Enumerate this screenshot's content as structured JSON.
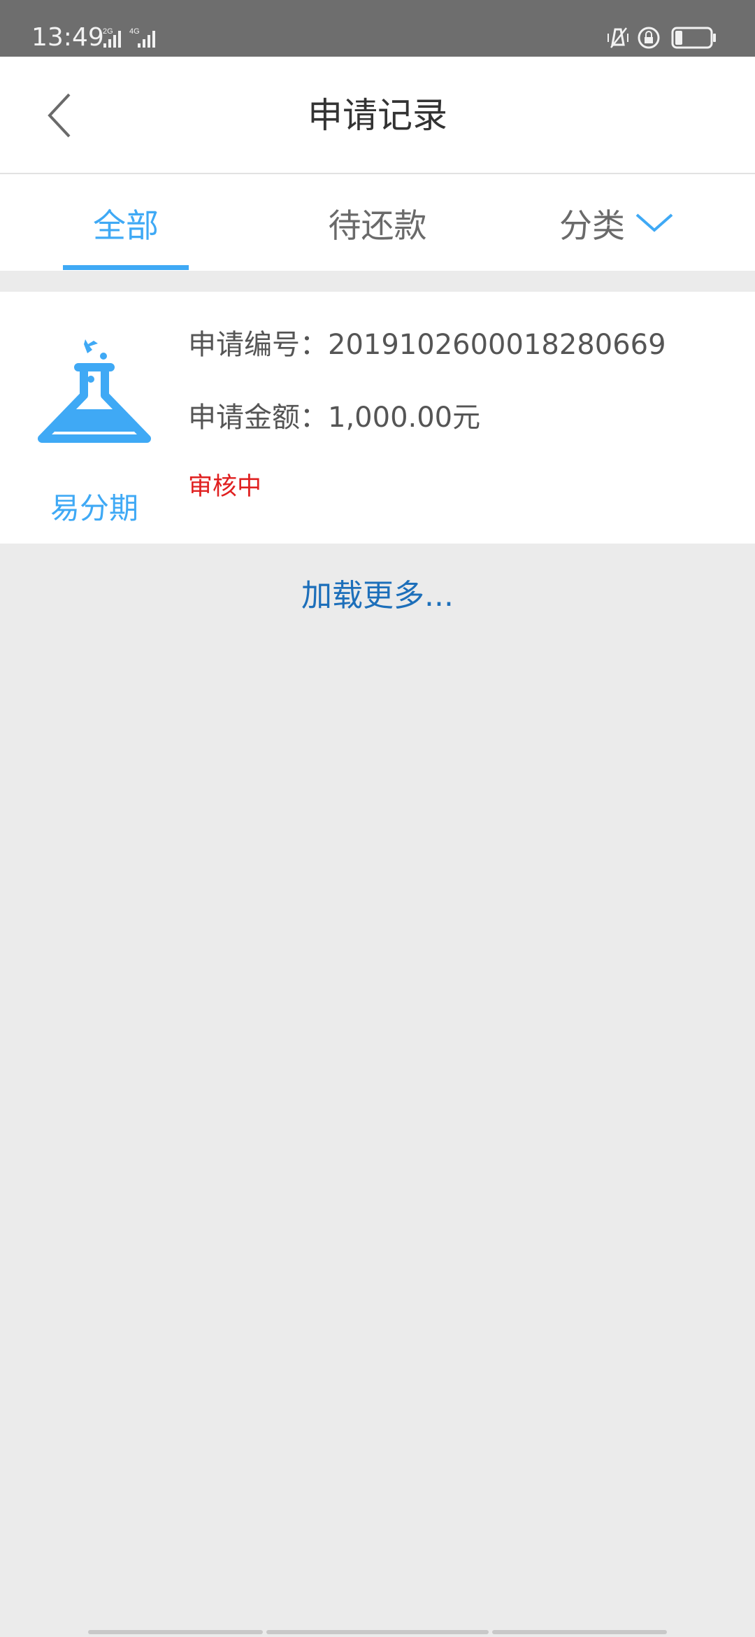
{
  "status_bar": {
    "time": "13:49",
    "signal1": "2G",
    "signal2": "4G"
  },
  "nav": {
    "title": "申请记录"
  },
  "tabs": [
    {
      "label": "全部",
      "active": true
    },
    {
      "label": "待还款",
      "active": false
    },
    {
      "label": "分类",
      "active": false
    }
  ],
  "record": {
    "product_name": "易分期",
    "application_no_label": "申请编号：",
    "application_no": "2019102600018280669",
    "amount_label": "申请金额：",
    "amount": "1,000.00元",
    "status": "审核中"
  },
  "load_more": "加载更多...",
  "colors": {
    "accent": "#3fa9f5",
    "status_red": "#e02020",
    "link_blue": "#1d6fba"
  }
}
